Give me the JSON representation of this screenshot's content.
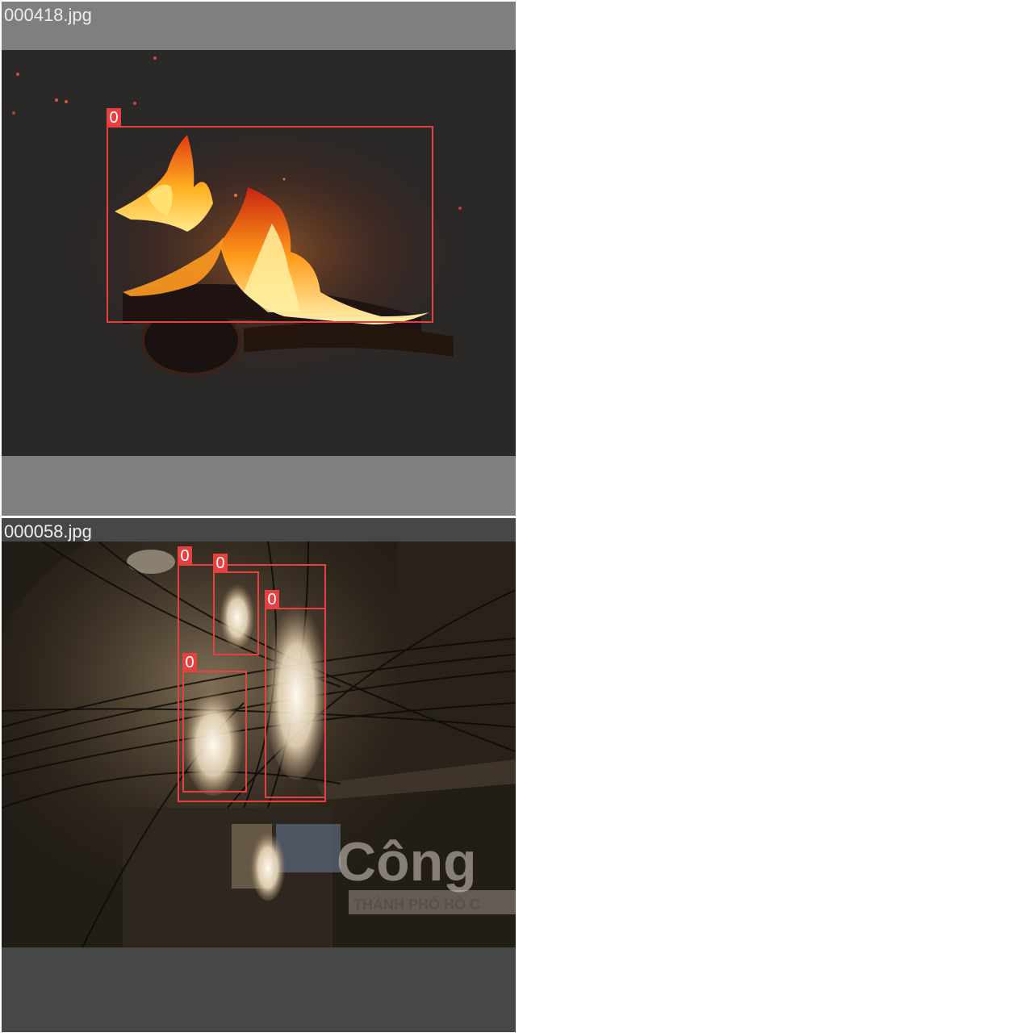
{
  "tiles": [
    {
      "filename": "000418.jpg",
      "detections": [
        {
          "class_label": "0"
        }
      ]
    },
    {
      "filename": "000058.jpg",
      "watermark_text": "Công",
      "watermark_subtext": "THÀNH PHỐ HỒ C",
      "detections": [
        {
          "class_label": "0"
        },
        {
          "class_label": "0"
        },
        {
          "class_label": "0"
        },
        {
          "class_label": "0"
        }
      ]
    }
  ],
  "colors": {
    "box": "#e84040",
    "tile1_border": "#7f7f7f",
    "tile2_border": "#474747",
    "label_text": "#ececec"
  }
}
